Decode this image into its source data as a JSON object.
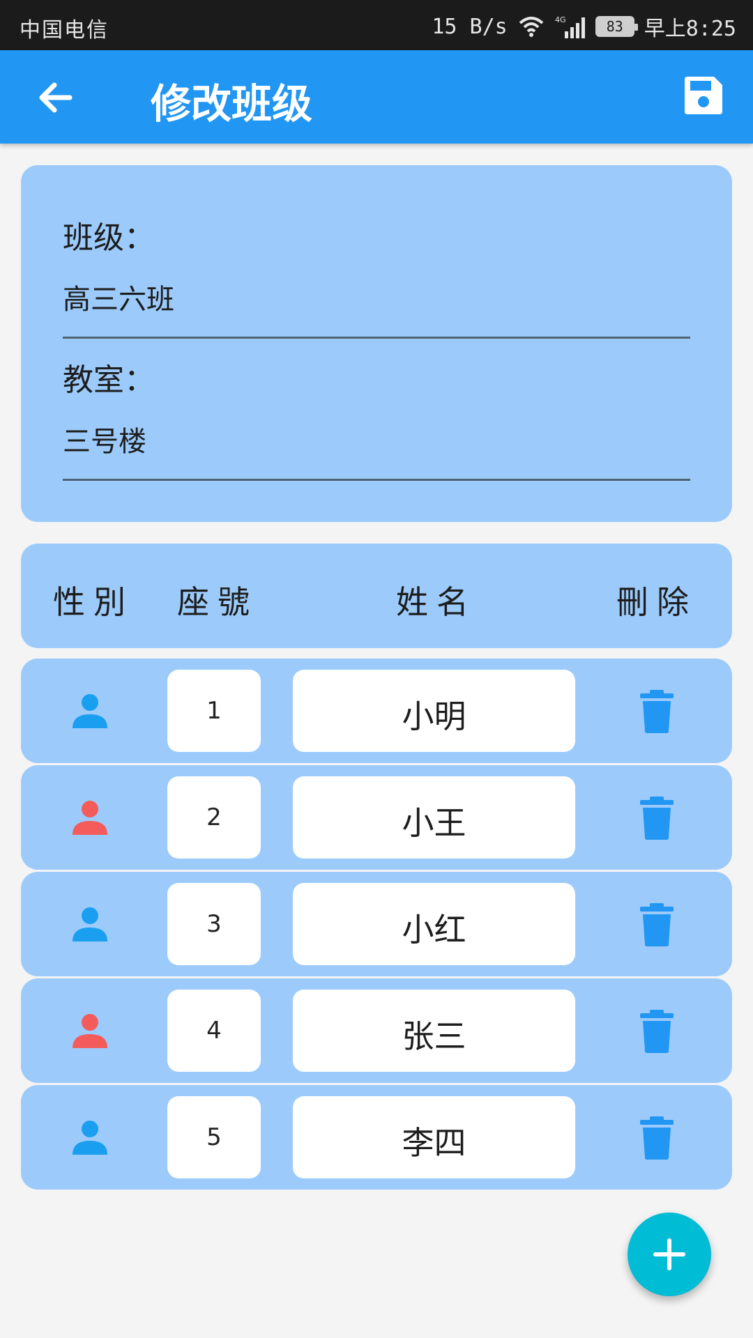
{
  "status_bar": {
    "carrier": "中国电信",
    "net_speed": "15 B/s",
    "network": "4G",
    "battery": "83",
    "time": "早上8:25"
  },
  "app_bar": {
    "title": "修改班级",
    "back_icon": "arrow-back-icon",
    "save_icon": "save-icon"
  },
  "form": {
    "class_label": "班级：",
    "class_value": "高三六班",
    "room_label": "教室：",
    "room_value": "三号楼"
  },
  "table": {
    "headers": [
      "性別",
      "座號",
      "姓名",
      "刪除"
    ],
    "rows": [
      {
        "gender": "male",
        "seat": "1",
        "name": "小明"
      },
      {
        "gender": "female",
        "seat": "2",
        "name": "小王"
      },
      {
        "gender": "male",
        "seat": "3",
        "name": "小红"
      },
      {
        "gender": "female",
        "seat": "4",
        "name": "张三"
      },
      {
        "gender": "male",
        "seat": "5",
        "name": "李四"
      }
    ]
  },
  "colors": {
    "app_bar": "#2196f3",
    "card": "#9ccbfb",
    "male": "#1a9ff0",
    "female": "#f45b5b",
    "delete": "#2196f3",
    "fab": "#00bcd4"
  },
  "fab": {
    "icon": "plus-icon"
  }
}
